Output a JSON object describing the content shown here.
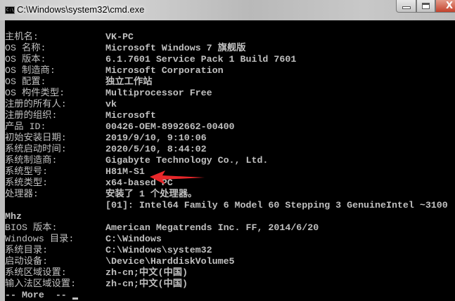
{
  "window": {
    "title": "C:\\Windows\\system32\\cmd.exe",
    "icon_text": "C:\\_",
    "close_glyph": "X"
  },
  "rows": [
    {
      "label": "主机名:",
      "value": "VK-PC"
    },
    {
      "label": "OS 名称:",
      "value": "Microsoft Windows 7 旗舰版"
    },
    {
      "label": "OS 版本:",
      "value": "6.1.7601 Service Pack 1 Build 7601"
    },
    {
      "label": "OS 制造商:",
      "value": "Microsoft Corporation"
    },
    {
      "label": "OS 配置:",
      "value": "独立工作站"
    },
    {
      "label": "OS 构件类型:",
      "value": "Multiprocessor Free"
    },
    {
      "label": "注册的所有人:",
      "value": "vk"
    },
    {
      "label": "注册的组织:",
      "value": "Microsoft"
    },
    {
      "label": "产品 ID:",
      "value": "00426-OEM-8992662-00400"
    },
    {
      "label": "初始安装日期:",
      "value": "2019/9/10, 9:10:06"
    },
    {
      "label": "系统启动时间:",
      "value": "2020/5/10, 8:44:02"
    },
    {
      "label": "系统制造商:",
      "value": "Gigabyte Technology Co., Ltd."
    },
    {
      "label": "系统型号:",
      "value": "H81M-S1"
    },
    {
      "label": "系统类型:",
      "value": "x64-based PC"
    },
    {
      "label": "处理器:",
      "value": "安装了 1 个处理器。"
    },
    {
      "label": "",
      "value": "[01]: Intel64 Family 6 Model 60 Stepping 3 GenuineIntel ~3100"
    },
    {
      "label": "Mhz",
      "value": ""
    },
    {
      "label": "BIOS 版本:",
      "value": "American Megatrends Inc. FF, 2014/6/20"
    },
    {
      "label": "Windows 目录:",
      "value": "C:\\Windows"
    },
    {
      "label": "系统目录:",
      "value": "C:\\Windows\\system32"
    },
    {
      "label": "启动设备:",
      "value": "\\Device\\HarddiskVolume5"
    },
    {
      "label": "系统区域设置:",
      "value": "zh-cn;中文(中国)"
    },
    {
      "label": "输入法区域设置:",
      "value": "zh-cn;中文(中国)"
    }
  ],
  "more_prompt": "-- More  --",
  "annotation_color": "#e8272a"
}
